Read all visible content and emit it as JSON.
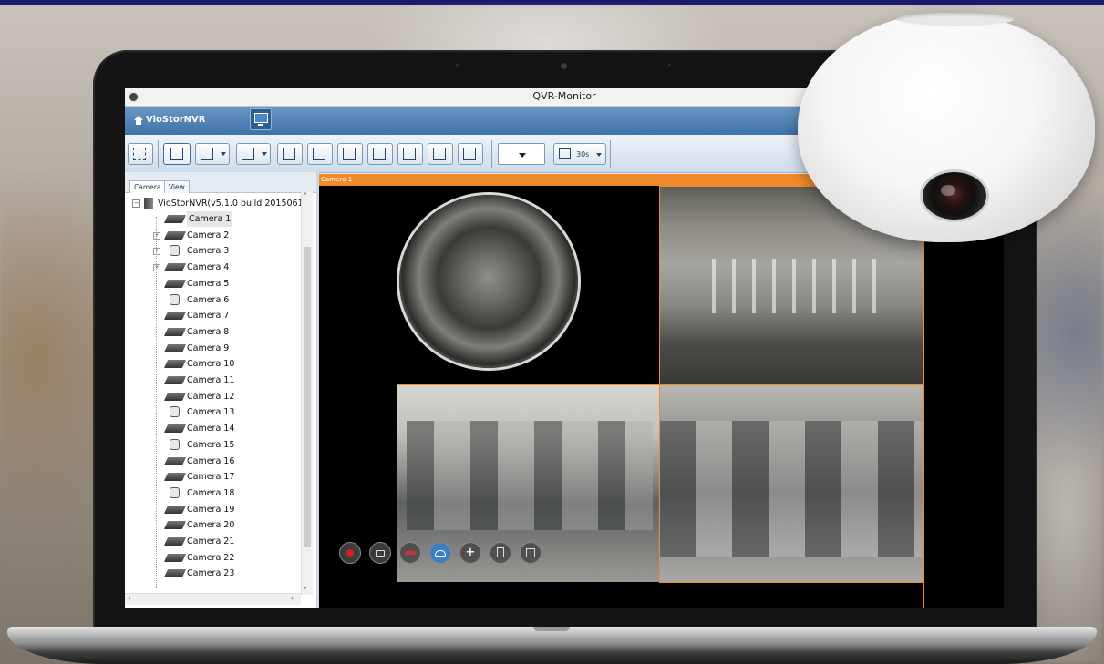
{
  "window": {
    "title": "QVR-Monitor"
  },
  "navbar": {
    "brand": "VioStorNVR"
  },
  "toolbar": {
    "sequence_interval": "30s"
  },
  "sidebar": {
    "tabs": [
      {
        "label": "Camera"
      },
      {
        "label": "View"
      }
    ],
    "root": {
      "label": "VioStorNVR(v5.1.0 build 2015061("
    },
    "cameras": [
      {
        "label": "Camera 1",
        "icon": "bullet-camera-icon",
        "selected": true
      },
      {
        "label": "Camera 2",
        "icon": "bullet-camera-icon",
        "expandable": true
      },
      {
        "label": "Camera 3",
        "icon": "dome-camera-icon",
        "expandable": true
      },
      {
        "label": "Camera 4",
        "icon": "bullet-camera-icon",
        "expandable": true
      },
      {
        "label": "Camera 5",
        "icon": "bullet-camera-icon"
      },
      {
        "label": "Camera 6",
        "icon": "dome-camera-icon"
      },
      {
        "label": "Camera 7",
        "icon": "bullet-camera-icon"
      },
      {
        "label": "Camera 8",
        "icon": "bullet-camera-icon"
      },
      {
        "label": "Camera 9",
        "icon": "bullet-camera-icon"
      },
      {
        "label": "Camera 10",
        "icon": "bullet-camera-icon"
      },
      {
        "label": "Camera 11",
        "icon": "bullet-camera-icon"
      },
      {
        "label": "Camera 12",
        "icon": "bullet-camera-icon"
      },
      {
        "label": "Camera 13",
        "icon": "dome-camera-icon"
      },
      {
        "label": "Camera 14",
        "icon": "bullet-camera-icon"
      },
      {
        "label": "Camera 15",
        "icon": "dome-camera-icon"
      },
      {
        "label": "Camera 16",
        "icon": "bullet-camera-icon"
      },
      {
        "label": "Camera 17",
        "icon": "bullet-camera-icon"
      },
      {
        "label": "Camera 18",
        "icon": "dome-camera-icon"
      },
      {
        "label": "Camera 19",
        "icon": "bullet-camera-icon"
      },
      {
        "label": "Camera 20",
        "icon": "bullet-camera-icon"
      },
      {
        "label": "Camera 21",
        "icon": "bullet-camera-icon"
      },
      {
        "label": "Camera 22",
        "icon": "bullet-camera-icon"
      },
      {
        "label": "Camera 23",
        "icon": "bullet-camera-icon"
      }
    ]
  },
  "viewer": {
    "active_camera": "Camera 1",
    "accent_color": "#f08a2a",
    "controls": [
      {
        "name": "record-button"
      },
      {
        "name": "snapshot-button"
      },
      {
        "name": "audio-button"
      },
      {
        "name": "fisheye-dewarp-button"
      },
      {
        "name": "ptz-button"
      },
      {
        "name": "info-button"
      },
      {
        "name": "layout-button"
      }
    ]
  },
  "colors": {
    "navbar": "#4a7db3",
    "record": "#d0201c",
    "tile_border": "#f08a2a"
  }
}
